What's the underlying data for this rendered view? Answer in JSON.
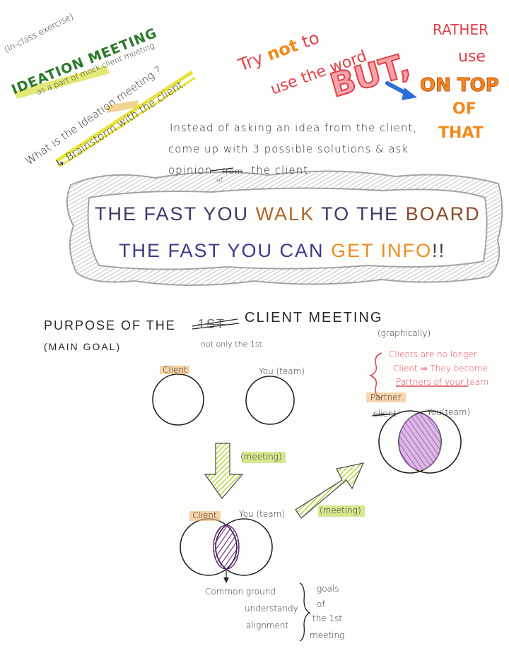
{
  "top_left": {
    "exercise_note": "(In-class exercise)",
    "title": "IDEATION MEETING",
    "subtitle": "as a part of mock client meeting",
    "question": "What is the Ideation meeting ?",
    "answer": "↳ Brainstorm with the client."
  },
  "tip": {
    "line1_prefix": "Try ",
    "line1_not": "not",
    "line1_suffix": " to",
    "line2": "use the word",
    "but_word": "BUT,",
    "rather": "RATHER",
    "use": "use",
    "on_top": "ON TOP",
    "of": "OF",
    "that": "THAT"
  },
  "instruction": {
    "line1": "Instead of asking an idea from the client,",
    "line2": "come up with 3 possible solutions & ask",
    "line3_a": "opinion",
    "line3_crossed": "from",
    "line3_insert": "of",
    "line3_b": "the client."
  },
  "banner": {
    "l1_a": "THE FAST YOU ",
    "l1_walk": "WALK",
    "l1_b": " TO THE ",
    "l1_board": "BOARD",
    "l2_a": "THE FAST YOU CAN ",
    "l2_get": "GET",
    "l2_info": " INFO",
    "l2_bang": "!!"
  },
  "purpose": {
    "title_a": "PURPOSE OF THE",
    "title_crossed": "1ST",
    "title_b": "CLIENT MEETING",
    "main_goal": "(MAIN GOAL)",
    "not_only": "not only the 1st",
    "graphically": "(graphically)"
  },
  "diagram": {
    "client_label": "Client",
    "you_team_label": "You (team)",
    "meeting_label_1": "(meeting)",
    "meeting_label_2": "(meeting)",
    "client_label_2": "Client",
    "you_team_label_2": "You (team)",
    "partner_label": "Partner",
    "client_crossed": "client",
    "you_team_label_3": "You(team)",
    "red_note_1": "Clients are no longer",
    "red_note_2": "Client ⇒ They become",
    "red_note_3": "Partners of your team",
    "outcome_1": "Common ground",
    "outcome_2": "understandy",
    "outcome_3": "alignment",
    "goals_1": "goals",
    "goals_2": "of",
    "goals_3": "the 1st",
    "goals_4": "meeting"
  },
  "colors": {
    "ink": "#2a2a2a",
    "red": "#e0404a",
    "orange": "#f08a1c",
    "purple": "#7a5ab8",
    "blue_pen": "#2a6fd8",
    "highlight_yellow": "#e6e23a",
    "highlight_green": "#9ed63a",
    "arrow_green": "#b8d94a",
    "overlap_purple": "#8a4aa8"
  }
}
